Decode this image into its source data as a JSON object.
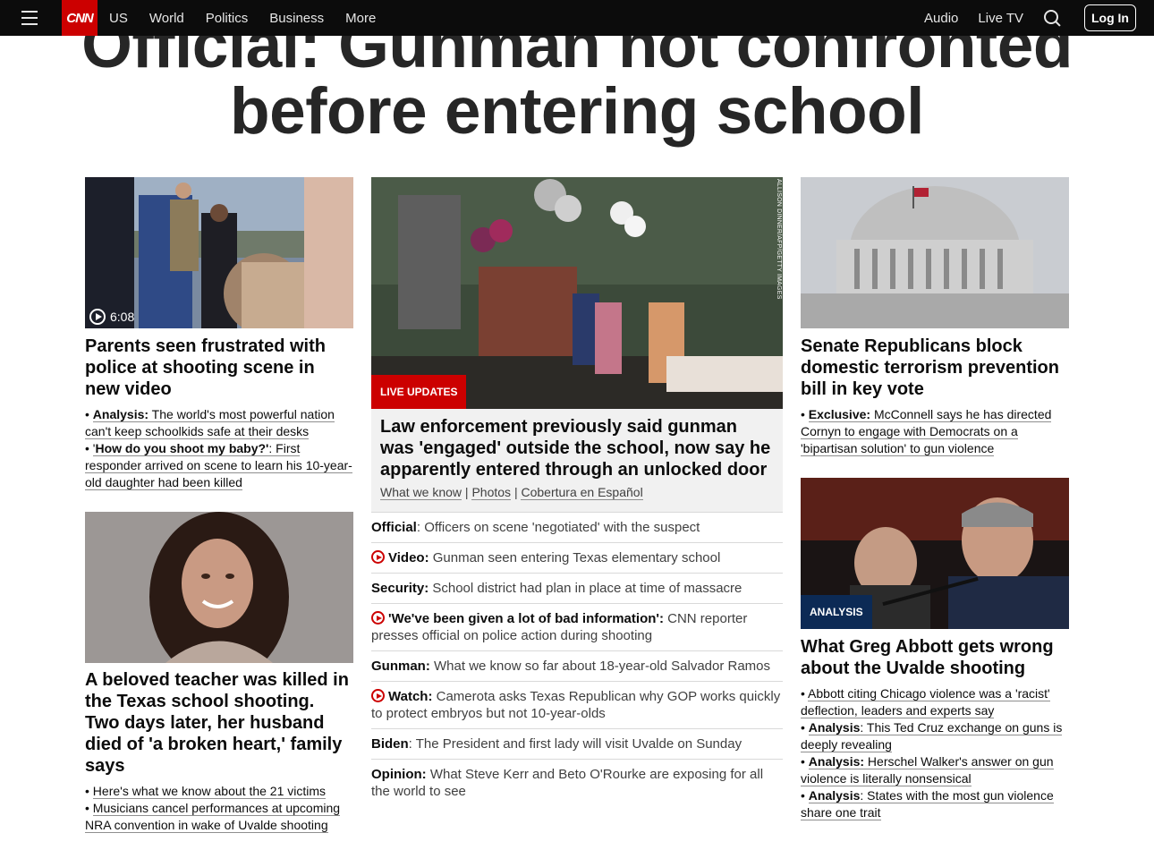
{
  "nav": {
    "logo": "CNN",
    "links": [
      "US",
      "World",
      "Politics",
      "Business",
      "More"
    ],
    "right_links": [
      "Audio",
      "Live TV"
    ],
    "login": "Log In"
  },
  "headline": "Official: Gunman not confronted before entering school",
  "left": {
    "story1": {
      "video_duration": "6:08",
      "title": "Parents seen frustrated with police at shooting scene in new video",
      "bullets": [
        {
          "label": "Analysis:",
          "text": " The world's most powerful nation can't keep schoolkids safe at their desks"
        },
        {
          "label": "How do you shoot my baby?'",
          "prefix": "'",
          "text": ": First responder arrived on scene to learn his 10-year-old daughter had been killed"
        }
      ]
    },
    "story2": {
      "title": "A beloved teacher was killed in the Texas school shooting. Two days later, her husband died of 'a broken heart,' family says",
      "bullets": [
        {
          "text": "Here's what we know about the 21 victims"
        },
        {
          "text": "Musicians cancel performances at upcoming NRA convention in wake of Uvalde shooting"
        }
      ]
    }
  },
  "middle": {
    "badge": "LIVE UPDATES",
    "photo_credit": "ALLISON DINNER/AFP/GETTY IMAGES",
    "title": "Law enforcement previously said gunman was 'engaged' outside the school, now say he apparently entered through an unlocked door",
    "sublinks": [
      "What we know",
      "Photos",
      "Cobertura en Español"
    ],
    "items": [
      {
        "label": "Official",
        "text": ": Officers on scene 'negotiated' with the suspect",
        "video": false,
        "bold_label": false
      },
      {
        "label": "Video:",
        "text": " Gunman seen entering Texas elementary school",
        "video": true
      },
      {
        "label": "Security:",
        "text": " School district had plan in place at time of massacre",
        "video": false
      },
      {
        "label": "'We've been given a lot of bad information':",
        "text": " CNN reporter presses official on police action during shooting",
        "video": true
      },
      {
        "label": "Gunman:",
        "text": " What we know so far about 18-year-old Salvador Ramos",
        "video": false
      },
      {
        "label": "Watch:",
        "text": " Camerota asks Texas Republican why GOP works quickly to protect embryos but not 10-year-olds",
        "video": true
      },
      {
        "label": "Biden",
        "text": ": The President and first lady will visit Uvalde on Sunday",
        "video": false
      },
      {
        "label": "Opinion:",
        "text": " What Steve Kerr and Beto O'Rourke are exposing for all the world to see",
        "video": false
      }
    ]
  },
  "right": {
    "story1": {
      "title": "Senate Republicans block domestic terrorism prevention bill in key vote",
      "bullets": [
        {
          "label": "Exclusive:",
          "text": " McConnell says he has directed Cornyn to engage with Democrats on a 'bipartisan solution' to gun violence"
        }
      ]
    },
    "story2": {
      "badge": "ANALYSIS",
      "title": "What Greg Abbott gets wrong about the Uvalde shooting",
      "bullets": [
        {
          "label": "",
          "text": "Abbott citing Chicago violence was a 'racist' deflection, leaders and experts say"
        },
        {
          "label": "Analysis",
          "text": ": This Ted Cruz exchange on guns is deeply revealing"
        },
        {
          "label": "Analysis:",
          "text": " Herschel Walker's answer on gun violence is literally nonsensical"
        },
        {
          "label": "Analysis",
          "text": ": States with the most gun violence share one trait"
        }
      ]
    }
  },
  "colors": {
    "nav_bg": "#0c0c0c",
    "brand_red": "#cc0000",
    "analysis_badge": "#0c2a55"
  }
}
